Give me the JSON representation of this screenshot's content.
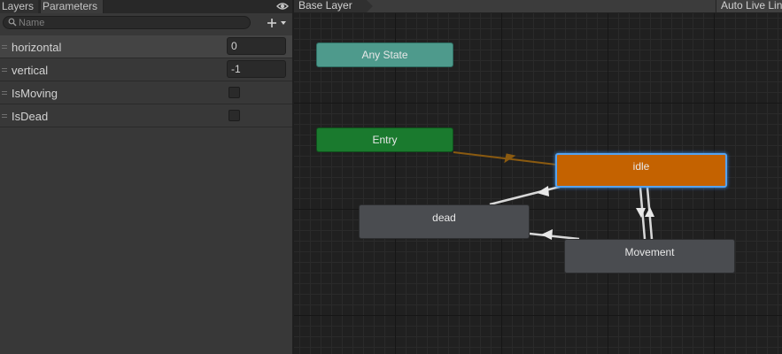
{
  "left_panel": {
    "tabs": [
      {
        "label": "Layers"
      },
      {
        "label": "Parameters"
      }
    ],
    "search": {
      "placeholder": "Name",
      "value": ""
    },
    "parameters": [
      {
        "name": "horizontal",
        "type": "float",
        "value": "0"
      },
      {
        "name": "vertical",
        "type": "float",
        "value": "-1"
      },
      {
        "name": "IsMoving",
        "type": "bool",
        "checked": false
      },
      {
        "name": "IsDead",
        "type": "bool",
        "checked": false
      }
    ]
  },
  "graph": {
    "breadcrumb": "Base Layer",
    "auto_live_link": "Auto Live Lin",
    "states": {
      "any_state": "Any State",
      "entry": "Entry",
      "idle": "idle",
      "dead": "dead",
      "movement": "Movement"
    }
  },
  "colors": {
    "any_state": "#4e9a8c",
    "entry": "#1a7a2e",
    "default_state": "#c46200",
    "selection": "#55a3f0",
    "state": "#4a4c50",
    "entry_transition": "#8a5a10",
    "transition": "#d8d8d8"
  },
  "icons": {
    "search": "search-icon",
    "visibility": "eye-icon",
    "add": "plus-dropdown-icon",
    "drag": "drag-handle-icon"
  }
}
